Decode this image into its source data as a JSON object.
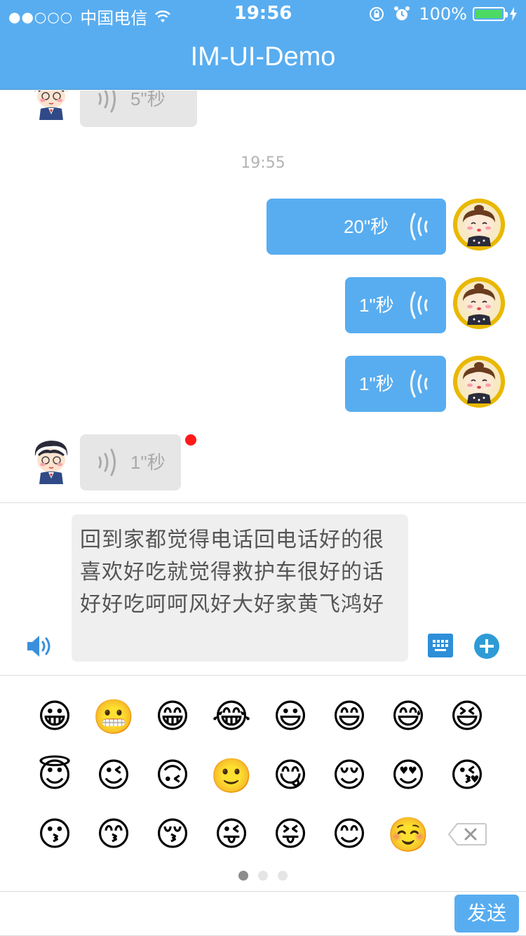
{
  "status_bar": {
    "signal": "●●○○○",
    "carrier": "中国电信",
    "time": "19:56",
    "battery": "100%"
  },
  "nav": {
    "title": "IM-UI-Demo"
  },
  "messages": [
    {
      "side": "in",
      "duration": "5\"秒"
    },
    {
      "timestamp": "19:55"
    },
    {
      "side": "out",
      "duration": "20\"秒"
    },
    {
      "side": "out",
      "duration": "1\"秒"
    },
    {
      "side": "out",
      "duration": "1\"秒"
    },
    {
      "side": "in",
      "duration": "1\"秒",
      "unread": true
    }
  ],
  "input": {
    "text": "回到家都觉得电话回电话好的很喜欢好吃就觉得救护车很好的话好好吃呵呵风好大好家黄飞鸿好"
  },
  "emoji": {
    "rows": [
      [
        "😀",
        "😬",
        "😁",
        "😂",
        "😃",
        "😄",
        "😅",
        "😆"
      ],
      [
        "😇",
        "😉",
        "🙃",
        "🙂",
        "😋",
        "😌",
        "😍",
        "😘"
      ],
      [
        "😗",
        "😙",
        "😚",
        "😜",
        "😝",
        "😊",
        "☺️"
      ]
    ],
    "pages": 3,
    "active_page": 0
  },
  "actions": {
    "send_label": "发送"
  },
  "colors": {
    "accent": "#58adf0",
    "bubble_in": "#e6e6e6",
    "unread": "#ff1a1a"
  }
}
